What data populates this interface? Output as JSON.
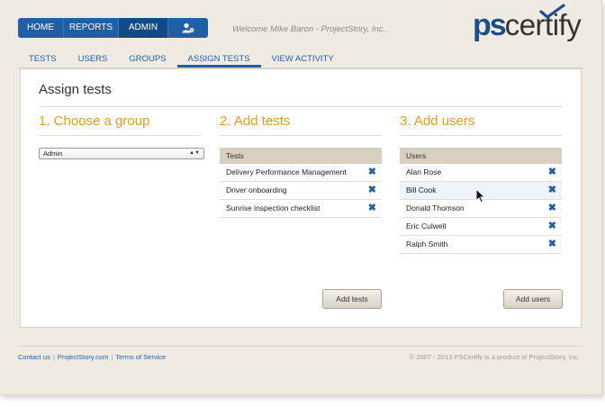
{
  "topnav": {
    "items": [
      {
        "label": "HOME"
      },
      {
        "label": "REPORTS"
      },
      {
        "label": "ADMIN",
        "active": true
      }
    ],
    "user_icon": "user-settings-icon"
  },
  "welcome": "Welcome Mike Baron - ProjectStory, Inc.",
  "logo": {
    "ps": "ps",
    "certify": "certify",
    "check_color": "#1d4e8c"
  },
  "tabs": [
    {
      "label": "TESTS"
    },
    {
      "label": "USERS"
    },
    {
      "label": "GROUPS"
    },
    {
      "label": "ASSIGN TESTS",
      "active": true
    },
    {
      "label": "VIEW ACTIVITY"
    }
  ],
  "page_title": "Assign tests",
  "step1": {
    "heading": "1. Choose a group",
    "selected_group": "Admin"
  },
  "step2": {
    "heading": "2. Add tests",
    "list_header": "Tests",
    "items": [
      "Delivery Performance Management",
      "Driver onboarding",
      "Sunrise inspection checklist"
    ],
    "button": "Add tests"
  },
  "step3": {
    "heading": "3. Add users",
    "list_header": "Users",
    "items": [
      "Alan Rose",
      "Bill Cook",
      "Donald Thomson",
      "Eric Culwell",
      "Ralph Smith"
    ],
    "button": "Add users"
  },
  "remove_icon": "close-icon",
  "footer": {
    "links": [
      "Contact us",
      "ProjectStory.com",
      "Terms of Service"
    ],
    "copyright": "© 2007 - 2013  PSCertify is a product of ProjectStory, Inc."
  },
  "colors": {
    "brand_blue": "#1f5fa6",
    "accent_orange": "#e89a1f",
    "header_tan": "#d7cfbf"
  }
}
